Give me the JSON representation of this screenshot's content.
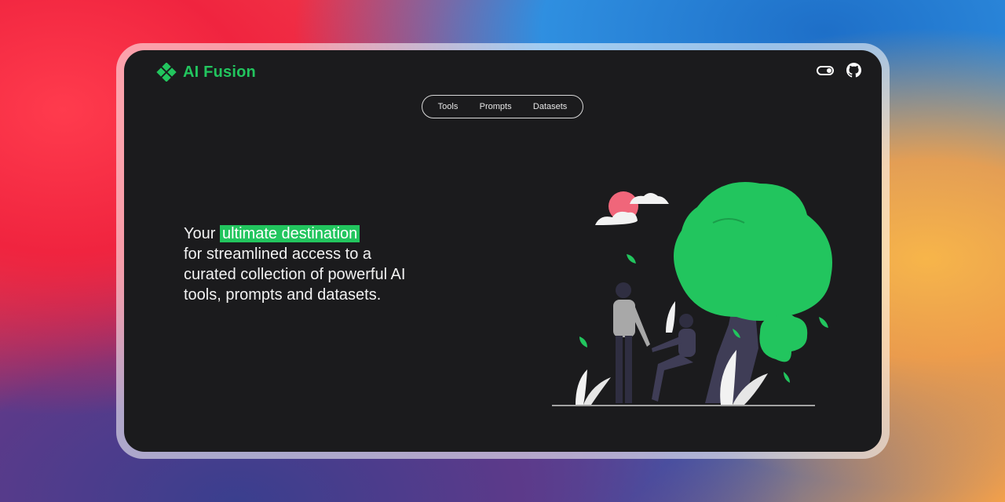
{
  "app": {
    "name": "AI Fusion",
    "brand_color": "#22c55e",
    "background_color": "#1b1b1d"
  },
  "header": {
    "theme_toggle_icon": "toggle-icon",
    "github_icon": "github-icon"
  },
  "nav": {
    "items": [
      {
        "label": "Tools"
      },
      {
        "label": "Prompts"
      },
      {
        "label": "Datasets"
      }
    ]
  },
  "hero": {
    "prefix": "Your ",
    "highlight": "ultimate destination",
    "suffix": "for streamlined access to a curated collection of powerful AI tools, prompts and datasets."
  }
}
